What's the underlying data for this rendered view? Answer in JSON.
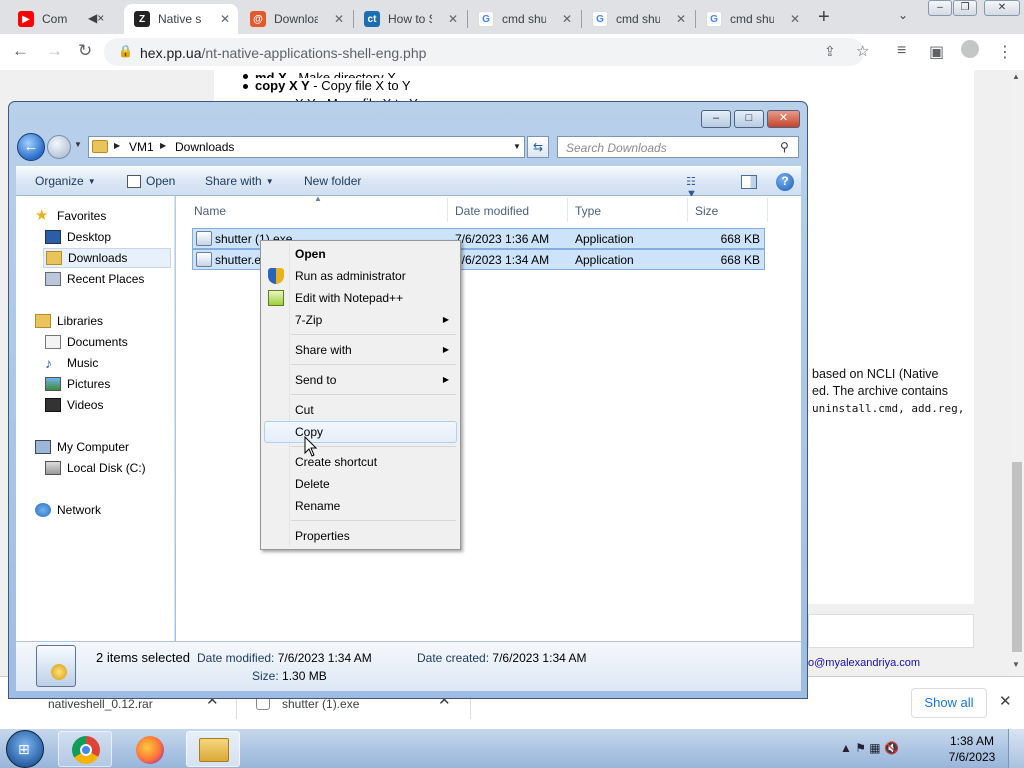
{
  "browser": {
    "tabs": [
      {
        "title": "Com",
        "icon": "youtube-icon"
      },
      {
        "title": "Native sh",
        "icon": "site-z-icon",
        "active": true
      },
      {
        "title": "Downloa",
        "icon": "at-sign-icon"
      },
      {
        "title": "How to S",
        "icon": "ct-icon"
      },
      {
        "title": "cmd shut",
        "icon": "google-icon"
      },
      {
        "title": "cmd shut",
        "icon": "google-icon"
      },
      {
        "title": "cmd shut",
        "icon": "google-icon"
      }
    ],
    "url_host": "hex.pp.ua",
    "url_path": "/nt-native-applications-shell-eng.php"
  },
  "page": {
    "line1_cmd": "md X",
    "line1_desc": " - Make directory X",
    "line2_cmd": "copy X Y",
    "line2_desc": " - Copy file X to Y",
    "line3": "X Y - Move file X to Y",
    "right1": "based on NCLI (Native",
    "right2": "ed. The archive contains",
    "right3": "uninstall.cmd, add.reg,",
    "email": "o@myalexandriya.com"
  },
  "shelf": {
    "item1": "nativeshell_0.12.rar",
    "item2": "shutter (1).exe",
    "show_all": "Show all"
  },
  "taskbar": {
    "time": "1:38 AM",
    "date": "7/6/2023"
  },
  "explorer": {
    "breadcrumb": [
      "VM1",
      "Downloads"
    ],
    "search_placeholder": "Search Downloads",
    "commands": {
      "organize": "Organize",
      "open": "Open",
      "share_with": "Share with",
      "new_folder": "New folder"
    },
    "nav": {
      "favorites": "Favorites",
      "desktop": "Desktop",
      "downloads": "Downloads",
      "recent_places": "Recent Places",
      "libraries": "Libraries",
      "documents": "Documents",
      "music": "Music",
      "pictures": "Pictures",
      "videos": "Videos",
      "my_computer": "My Computer",
      "local_disk": "Local Disk (C:)",
      "network": "Network"
    },
    "columns": {
      "name": "Name",
      "date_modified": "Date modified",
      "type": "Type",
      "size": "Size"
    },
    "files": [
      {
        "name": "shutter (1).exe",
        "date": "7/6/2023 1:36 AM",
        "type": "Application",
        "size": "668 KB"
      },
      {
        "name": "shutter.exe",
        "date": "7/6/2023 1:34 AM",
        "type": "Application",
        "size": "668 KB"
      }
    ],
    "details": {
      "selected": "2 items selected",
      "date_modified_label": "Date modified:",
      "date_modified": "7/6/2023 1:34 AM",
      "date_created_label": "Date created:",
      "date_created": "7/6/2023 1:34 AM",
      "size_label": "Size:",
      "size": "1.30 MB"
    }
  },
  "context_menu": {
    "open": "Open",
    "run_as_admin": "Run as administrator",
    "edit_notepad": "Edit with Notepad++",
    "zip": "7-Zip",
    "share_with": "Share with",
    "send_to": "Send to",
    "cut": "Cut",
    "copy": "Copy",
    "create_shortcut": "Create shortcut",
    "delete": "Delete",
    "rename": "Rename",
    "properties": "Properties"
  }
}
